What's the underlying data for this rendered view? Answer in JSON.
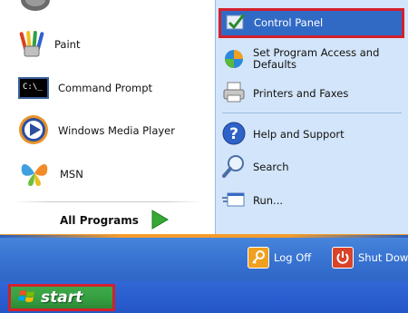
{
  "left_pane": {
    "items": [
      {
        "label": "Paint",
        "icon": "paint-icon"
      },
      {
        "label": "Command Prompt",
        "icon": "command-prompt-icon",
        "icon_text": "C:\\_"
      },
      {
        "label": "Windows Media Player",
        "icon": "media-player-icon"
      },
      {
        "label": "MSN",
        "icon": "msn-butterfly-icon"
      }
    ],
    "all_programs": {
      "label": "All Programs",
      "icon": "green-arrow-icon"
    }
  },
  "right_pane": {
    "items": [
      {
        "label": "Control Panel",
        "icon": "control-panel-icon",
        "highlighted": true
      },
      {
        "label": "Set Program Access and Defaults",
        "line1": "Set Program Access and",
        "line2": "Defaults",
        "icon": "program-access-icon"
      },
      {
        "label": "Printers and Faxes",
        "icon": "printer-icon"
      },
      {
        "label": "Help and Support",
        "icon": "help-icon"
      },
      {
        "label": "Search",
        "icon": "search-icon"
      },
      {
        "label": "Run...",
        "icon": "run-icon"
      }
    ]
  },
  "bottom_bar": {
    "log_off": {
      "label": "Log Off",
      "icon": "key-icon"
    },
    "shut_down": {
      "label": "Shut Dow",
      "icon": "power-icon"
    }
  },
  "taskbar": {
    "start": {
      "label": "start",
      "icon": "windows-flag-icon"
    }
  },
  "colors": {
    "highlight": "#316ac5",
    "annotation_border": "#d3202c",
    "right_pane_bg": "#d3e5fa",
    "start_green": "#36a041",
    "taskbar_blue": "#2456c8"
  }
}
